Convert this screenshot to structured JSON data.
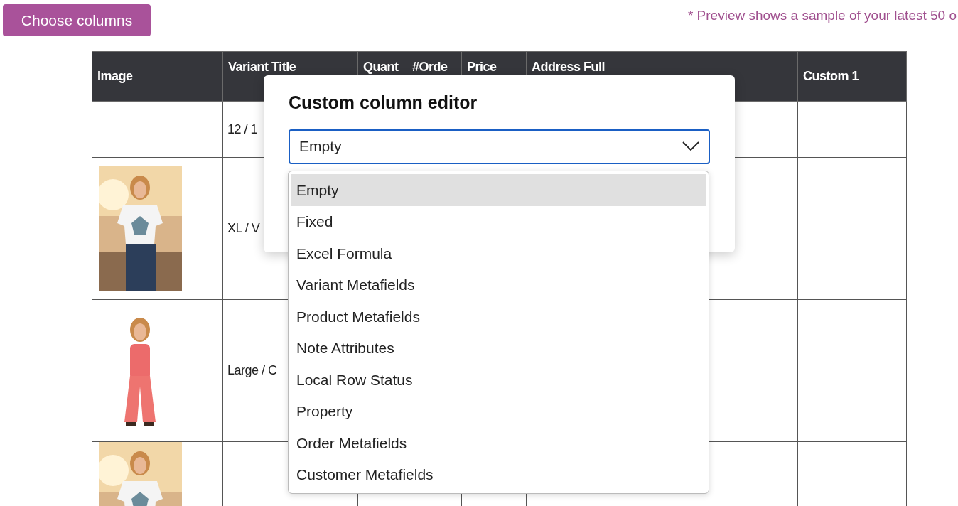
{
  "toolbar": {
    "button": "Choose columns",
    "note": "* Preview shows a sample of your latest 50 o"
  },
  "table": {
    "columns": [
      "Image",
      "Variant Title",
      "Quant",
      "#Orde",
      "Price",
      "Address Full",
      "Custom 1"
    ],
    "rows": [
      {
        "image": null,
        "variant_title": "12 / 1"
      },
      {
        "image": {
          "kind": "picture"
        },
        "variant_title": "XL / V"
      },
      {
        "image": {
          "kind": "picture"
        },
        "variant_title": "Large / C"
      },
      {
        "image": {
          "kind": "picture"
        }
      }
    ]
  },
  "dialog": {
    "title": "Custom column editor",
    "select": {
      "value": "Empty",
      "expanded": true,
      "options": [
        {
          "label": "Empty",
          "selected": true
        },
        {
          "label": "Fixed",
          "selected": false
        },
        {
          "label": "Excel Formula",
          "selected": false
        },
        {
          "label": "Variant Metafields",
          "selected": false
        },
        {
          "label": "Product Metafields",
          "selected": false
        },
        {
          "label": "Note Attributes",
          "selected": false
        },
        {
          "label": "Local Row Status",
          "selected": false
        },
        {
          "label": "Property",
          "selected": false
        },
        {
          "label": "Order Metafields",
          "selected": false
        },
        {
          "label": "Customer Metafields",
          "selected": false
        }
      ]
    }
  }
}
